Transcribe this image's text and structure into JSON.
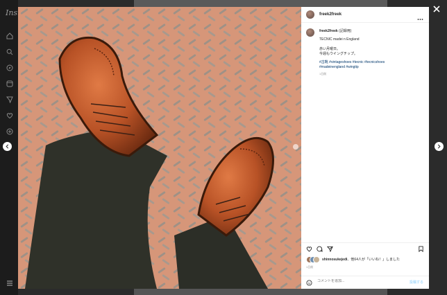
{
  "background_app": {
    "logo_text": "Insta"
  },
  "post": {
    "author": "freek2freek",
    "caption_author": "freek2freek",
    "caption_title": "(記録用)",
    "caption_lines": [
      "TECNIC madei n England",
      "",
      "赤い月曜日。",
      "今週もウイングチップ。"
    ],
    "hashtags_line1": "#古靴 #vintageshoes #tecnic #tecnicshoes",
    "hashtags_line2": "#madeinengland #wingtip",
    "caption_age": "1日前",
    "likes_user": "shinnosukejedi",
    "likes_text": "他64人が「いいね！」しました",
    "post_time": "1日前",
    "comment_placeholder": "コメントを追加...",
    "post_button_label": "投稿する"
  },
  "icons": {
    "close": "close-icon",
    "prev": "chevron-left-icon",
    "next": "chevron-right-icon",
    "more": "more-horizontal-icon",
    "like": "heart-icon",
    "comment": "comment-icon",
    "share": "paper-plane-icon",
    "save": "bookmark-icon",
    "emoji": "emoji-icon"
  },
  "colors": {
    "hashtag": "#00376b",
    "post_button_disabled": "#b2dffc"
  }
}
